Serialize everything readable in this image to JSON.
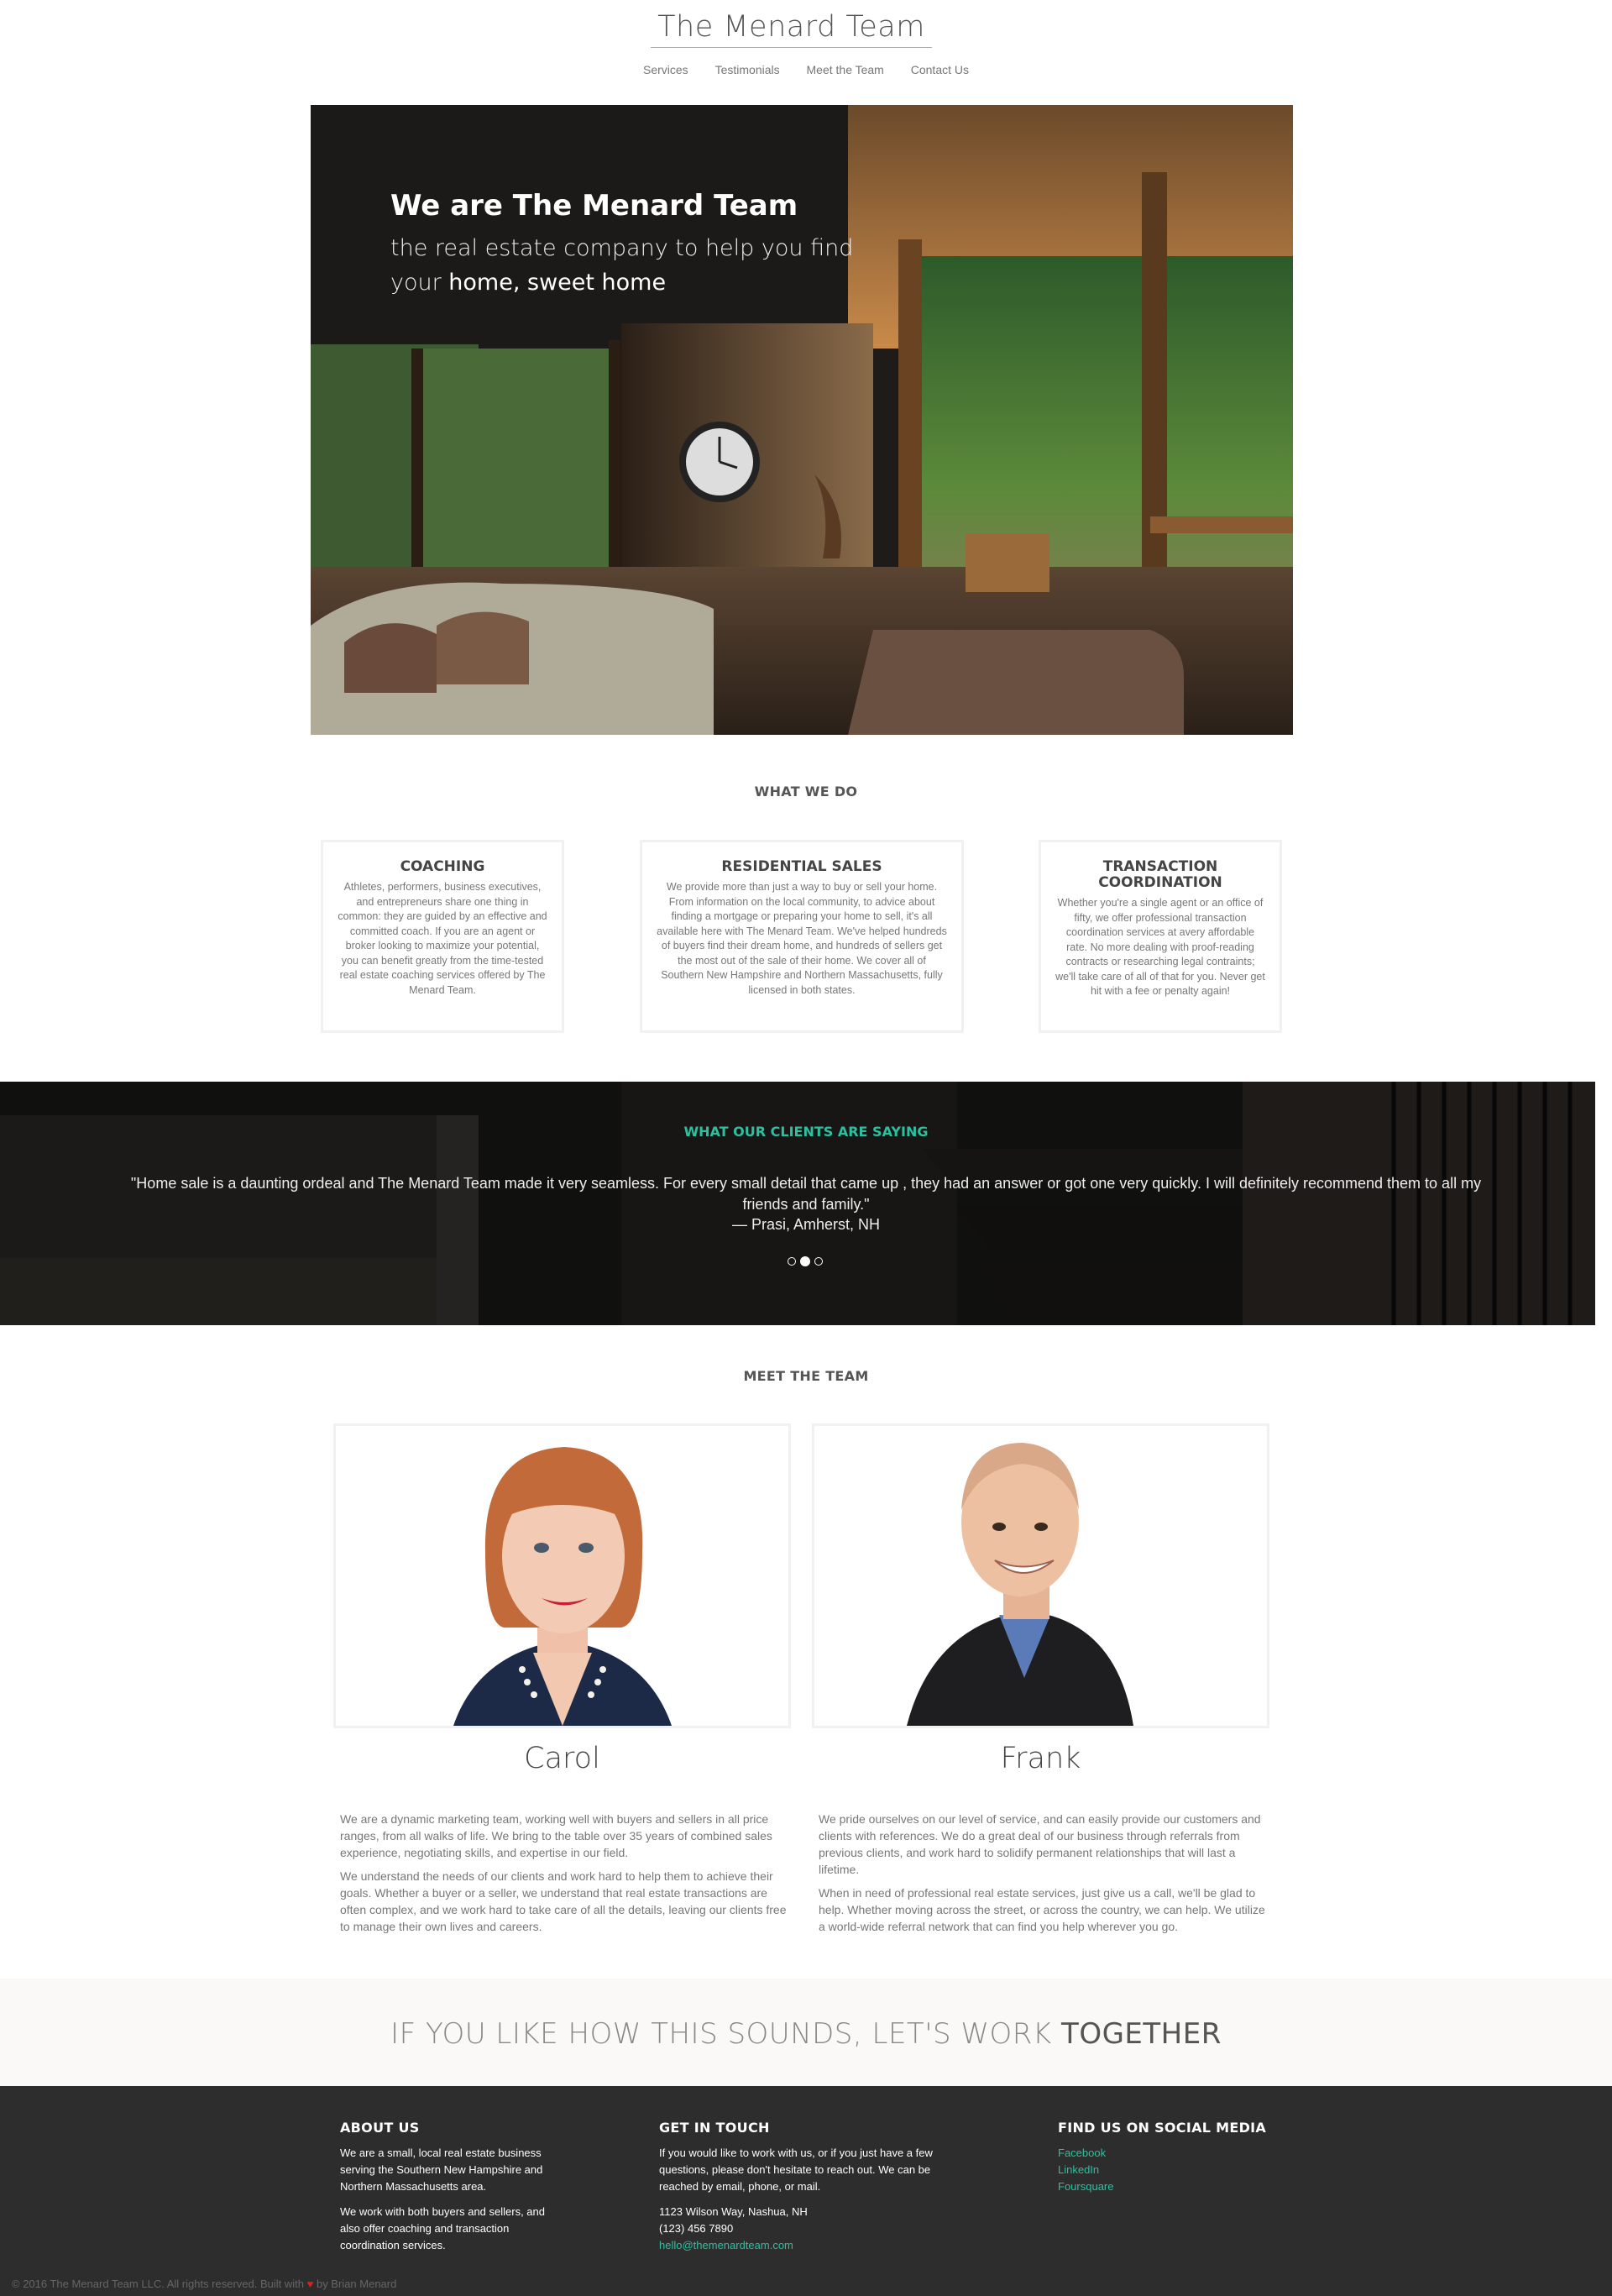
{
  "header": {
    "brand": "The Menard Team",
    "nav": [
      "Services",
      "Testimonials",
      "Meet the Team",
      "Contact Us"
    ]
  },
  "hero": {
    "title": "We are The Menard Team",
    "subtitle_prefix": "the real estate company to help you find your ",
    "subtitle_strong": "home, sweet home"
  },
  "services": {
    "title": "WHAT WE DO",
    "cards": [
      {
        "title": "COACHING",
        "text": "Athletes, performers, business executives, and entrepreneurs share one thing in common: they are guided by an effective and committed coach. If you are an agent or broker looking to maximize your potential, you can benefit greatly from the time-tested real estate coaching services offered by The Menard Team."
      },
      {
        "title": "RESIDENTIAL SALES",
        "text": "We provide more than just a way to buy or sell your home. From information on the local community, to advice about finding a mortgage or preparing your home to sell, it's all available here with The Menard Team. We've helped hundreds of buyers find their dream home, and hundreds of sellers get the most out of the sale of their home. We cover all of Southern New Hampshire and Northern Massachusetts, fully licensed in both states."
      },
      {
        "title": "TRANSACTION COORDINATION",
        "text": "Whether you're a single agent or an office of fifty, we offer professional transaction coordination services at avery affordable rate. No more dealing with proof-reading contracts or researching legal contraints; we'll take care of all of that for you. Never get hit with a fee or penalty again!"
      }
    ]
  },
  "testimonials": {
    "title": "WHAT OUR CLIENTS ARE SAYING",
    "quote": "\"Home sale is a daunting ordeal and The Menard Team made it very seamless. For every small detail that came up , they had an answer or got one very quickly. I will definitely recommend them to all my friends and family.\"",
    "author": "— Prasi, Amherst, NH",
    "active_slide": 2,
    "slide_count": 3
  },
  "team": {
    "title": "MEET THE TEAM",
    "members": [
      {
        "name": "Carol",
        "bio": [
          "We are a dynamic marketing team, working well with buyers and sellers in all price ranges, from all walks of life. We bring to the table over 35 years of combined sales experience, negotiating skills, and expertise in our field.",
          "We understand the needs of our clients and work hard to help them to achieve their goals. Whether a buyer or a seller, we understand that real estate transactions are often complex, and we work hard to take care of all the details, leaving our clients free to manage their own lives and careers."
        ]
      },
      {
        "name": "Frank",
        "bio": [
          "We pride ourselves on our level of service, and can easily provide our customers and clients with references. We do a great deal of our business through referrals from previous clients, and work hard to solidify permanent relationships that will last a lifetime.",
          "When in need of professional real estate services, just give us a call, we'll be glad to help. Whether moving across the street, or across the country, we can help. We utilize a world-wide referral network that can find you help wherever you go."
        ]
      }
    ]
  },
  "cta": {
    "text": "IF YOU LIKE HOW THIS SOUNDS, LET'S WORK ",
    "strong": "TOGETHER"
  },
  "footer": {
    "about": {
      "title": "ABOUT US",
      "p1": "We are a small, local real estate business serving the Southern New Hampshire and Northern Massachusetts area.",
      "p2": "We work with both buyers and sellers, and also offer coaching and transaction coordination services."
    },
    "contact": {
      "title": "GET IN TOUCH",
      "p1": "If you would like to work with us, or if you just have a few questions, please don't hesitate to reach out. We can be reached by email, phone, or mail.",
      "address": "1123 Wilson Way, Nashua, NH",
      "phone": "(123) 456 7890",
      "email": "hello@themenardteam.com"
    },
    "social": {
      "title": "FIND US ON SOCIAL MEDIA",
      "links": [
        "Facebook",
        "LinkedIn",
        "Foursquare"
      ]
    },
    "copyright_prefix": "© 2016 The Menard Team LLC. All rights reserved. Built with",
    "copyright_suffix": "by Brian Menard"
  },
  "colors": {
    "accent": "#2cc0a0",
    "footer_bg": "#2d2d2d",
    "heart": "#e02020"
  }
}
